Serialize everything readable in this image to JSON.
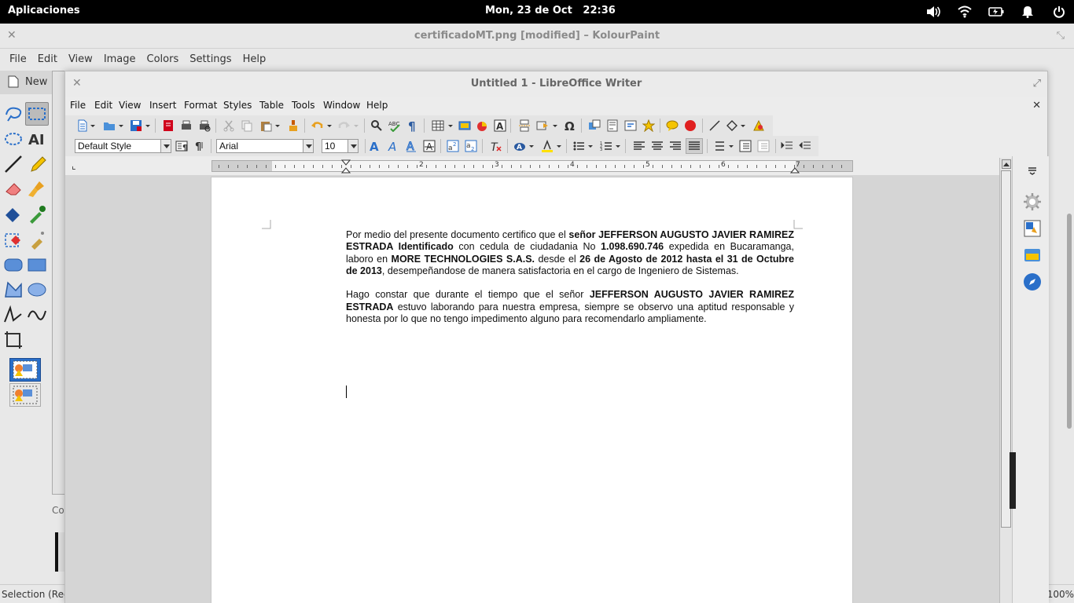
{
  "topbar": {
    "apps_label": "Aplicaciones",
    "date": "Mon, 23 de Oct",
    "time": "22:36"
  },
  "kolourpaint": {
    "title": "certificadoMT.png [modified] – KolourPaint",
    "menu": [
      "File",
      "Edit",
      "View",
      "Image",
      "Colors",
      "Settings",
      "Help"
    ],
    "new_label": "New",
    "status_left": "Selection (Rec",
    "status_right": "100%",
    "co_label": "Co",
    "tools": [
      "free-select-icon",
      "rect-select-icon",
      "ellipse-select-icon",
      "text-tool-icon",
      "line-icon",
      "pencil-icon",
      "eraser-icon",
      "brush-icon",
      "flood-fill-icon",
      "color-picker-icon",
      "color-eraser-icon",
      "spraycan-icon",
      "rounded-rect-icon",
      "rect-icon",
      "polygon-icon",
      "ellipse-icon",
      "polyline-icon",
      "curve-icon",
      "zoom-icon"
    ]
  },
  "writer": {
    "title": "Untitled 1 - LibreOffice Writer",
    "menu": [
      "File",
      "Edit",
      "View",
      "Insert",
      "Format",
      "Styles",
      "Table",
      "Tools",
      "Window",
      "Help"
    ],
    "paragraph_style": "Default Style",
    "font_name": "Arial",
    "font_size": "10",
    "ruler_numbers": [
      "1",
      "2",
      "3",
      "4",
      "5",
      "6",
      "7"
    ],
    "paragraphs": [
      [
        {
          "t": "Por medio del presente documento certifico que el ",
          "b": false
        },
        {
          "t": "señor JEFFERSON AUGUSTO JAVIER RAMIREZ ESTRADA Identificado",
          "b": true
        },
        {
          "t": " con cedula de ciudadania No ",
          "b": false
        },
        {
          "t": "1.098.690.746",
          "b": true
        },
        {
          "t": " expedida en Bucaramanga, laboro en ",
          "b": false
        },
        {
          "t": "MORE TECHNOLOGIES S.A.S.",
          "b": true
        },
        {
          "t": " desde el ",
          "b": false
        },
        {
          "t": "26 de Agosto de 2012 hasta el 31 de Octubre de 2013",
          "b": true
        },
        {
          "t": ", desempeñandose de manera satisfactoria en el cargo de Ingeniero de Sistemas.",
          "b": false
        }
      ],
      [
        {
          "t": "Hago constar que durante el tiempo que el señor ",
          "b": false
        },
        {
          "t": "JEFFERSON AUGUSTO JAVIER RAMIREZ ESTRADA",
          "b": true
        },
        {
          "t": " estuvo laborando para nuestra empresa, siempre se observo una aptitud responsable y honesta por lo que no tengo impedimento alguno para recomendarlo ampliamente.",
          "b": false
        }
      ]
    ]
  },
  "colors": {
    "accent_blue": "#2a6fc9",
    "save_red": "#d0021b",
    "comment_yellow": "#f5c400",
    "record_red": "#e02020"
  }
}
